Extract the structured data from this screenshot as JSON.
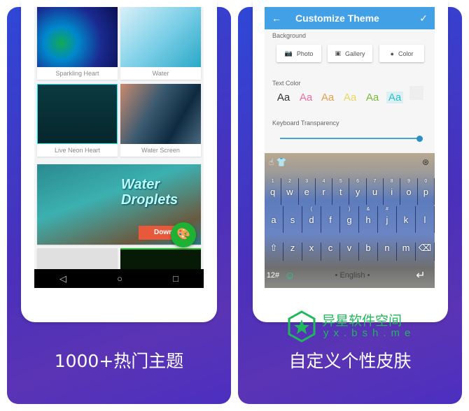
{
  "left_panel": {
    "caption": "1000+热门主题",
    "themes": [
      {
        "label": "Sparkling Heart"
      },
      {
        "label": "Water"
      },
      {
        "label": "Live Neon Heart"
      },
      {
        "label": "Water Screen"
      }
    ],
    "banner": {
      "title": "Water Droplets",
      "button": "Down"
    },
    "nav": {
      "back": "◁",
      "home": "○",
      "recents": "□"
    },
    "fab_icon": "palette-icon"
  },
  "right_panel": {
    "caption": "自定义个性皮肤",
    "appbar": {
      "back_icon": "←",
      "title": "Customize Theme",
      "confirm_icon": "✓"
    },
    "background_label": "Background",
    "buttons": [
      {
        "label": "Photo",
        "icon": "camera-icon"
      },
      {
        "label": "Gallery",
        "icon": "image-icon"
      },
      {
        "label": "Color",
        "icon": "palette-icon"
      }
    ],
    "text_color_label": "Text Color",
    "swatches": [
      {
        "text": "Aa",
        "color": "#333333"
      },
      {
        "text": "Aa",
        "color": "#e86fa0"
      },
      {
        "text": "Aa",
        "color": "#e0a050"
      },
      {
        "text": "Aa",
        "color": "#e8d860"
      },
      {
        "text": "Aa",
        "color": "#7ab83a"
      },
      {
        "text": "Aa",
        "color": "#28c0c8",
        "selected": true
      }
    ],
    "transparency_label": "Keyboard Transparency",
    "transparency_value": 1.0,
    "keyboard": {
      "row1": [
        [
          "q",
          "1"
        ],
        [
          "w",
          "2"
        ],
        [
          "e",
          "3"
        ],
        [
          "r",
          "4"
        ],
        [
          "t",
          "5"
        ],
        [
          "y",
          "6"
        ],
        [
          "u",
          "7"
        ],
        [
          "i",
          "8"
        ],
        [
          "o",
          "9"
        ],
        [
          "p",
          "0"
        ]
      ],
      "row2": [
        [
          "a",
          ""
        ],
        [
          "s",
          ""
        ],
        [
          "d",
          "("
        ],
        [
          "f",
          ""
        ],
        [
          "g",
          ")"
        ],
        [
          "h",
          "&"
        ],
        [
          "j",
          "#"
        ],
        [
          "k",
          ""
        ],
        [
          "l",
          ""
        ]
      ],
      "row3": [
        "⇧",
        "z",
        "x",
        "c",
        "v",
        "b",
        "n",
        "m",
        "⌫"
      ],
      "row4": {
        "mode": "12#",
        "emoji": "☺",
        "space": "• English •",
        "enter": "↵"
      }
    }
  },
  "watermark": {
    "name": "异星软件空间",
    "url": "yx.bsh.me"
  }
}
